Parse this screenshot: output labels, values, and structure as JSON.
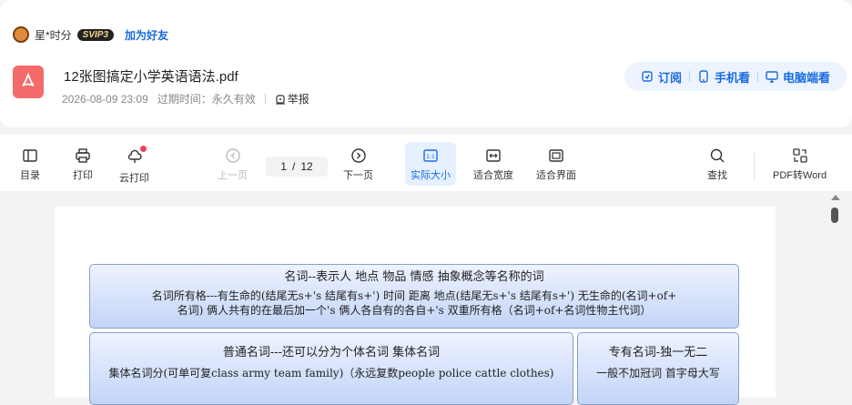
{
  "user": {
    "name": "星*时分",
    "badge": "SVIP3",
    "add_friend": "加为好友"
  },
  "file": {
    "title": "12张图搞定小学英语语法.pdf",
    "date": "2026-08-09 23:09",
    "expiry": "过期时间：永久有效",
    "report": "举报"
  },
  "actions": {
    "subscribe": "订阅",
    "mobile": "手机看",
    "desktop": "电脑端看"
  },
  "toolbar": {
    "toc": "目录",
    "print": "打印",
    "cloud_print": "云打印",
    "prev": "上一页",
    "page_current": "1",
    "page_sep": "/",
    "page_total": "12",
    "next": "下一页",
    "actual_size": "实际大小",
    "fit_width": "适合宽度",
    "fit_page": "适合界面",
    "search": "查找",
    "pdf_to_word": "PDF转Word"
  },
  "document": {
    "box1_title": "名词--表示人 地点 物品 情感 抽象概念等名称的词",
    "box1_line2": "名词所有格---有生命的(结尾无s+'s  结尾有s+')         时间 距离 地点(结尾无s+'s  结尾有s+')          无生命的(名词+of+",
    "box1_line3": "名词)    俩人共有的在最后加一个's    俩人各自有的各自+'s       双重所有格（名词+of+名词性物主代词）",
    "box2_title": "普通名词---还可以分为个体名词  集体名词",
    "box2_line2": "集体名词分(可单可复class army team family)（永远复数people police cattle clothes)",
    "box3_title": "专有名词-独一无二",
    "box3_line2": "一般不加冠词  首字母大写"
  },
  "colors": {
    "accent": "#1a6ce0",
    "pdf_icon": "#f36b6b",
    "box_fill": "#c3d4f7"
  }
}
